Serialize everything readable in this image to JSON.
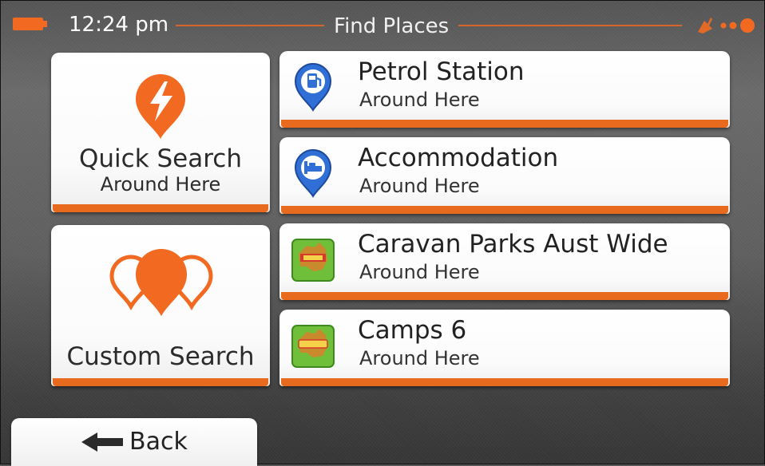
{
  "status": {
    "time": "12:24 pm",
    "title": "Find Places",
    "battery_icon": "battery-icon",
    "gps_icon": "gps-satellite-icon"
  },
  "colors": {
    "accent": "#e86a1f",
    "pin_blue": "#2f6fd6",
    "green": "#6fbf3a"
  },
  "left": {
    "quick": {
      "title": "Quick Search",
      "subtitle": "Around Here",
      "icon": "lightning-pin-icon"
    },
    "custom": {
      "title": "Custom Search",
      "icon": "multi-pin-icon"
    }
  },
  "list": [
    {
      "title": "Petrol Station",
      "subtitle": "Around Here",
      "icon": "fuel-pin-icon"
    },
    {
      "title": "Accommodation",
      "subtitle": "Around Here",
      "icon": "bed-pin-icon"
    },
    {
      "title": "Caravan Parks Aust Wide",
      "subtitle": "Around Here",
      "icon": "caravan-parks-map-icon"
    },
    {
      "title": "Camps 6",
      "subtitle": "Around Here",
      "icon": "camps-map-icon"
    }
  ],
  "back": {
    "label": "Back",
    "icon": "arrow-left-icon"
  }
}
